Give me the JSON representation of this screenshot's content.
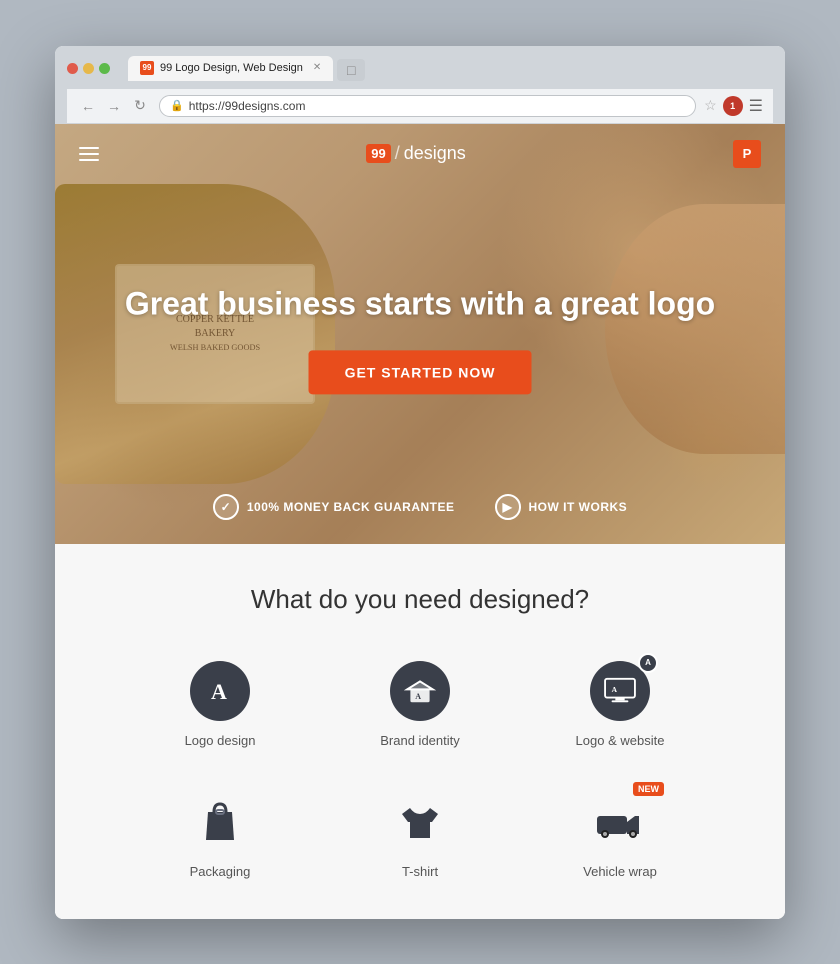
{
  "browser": {
    "tab_label": "99 Logo Design, Web Design",
    "tab_favicon": "99",
    "url": "https://99designs.com",
    "new_tab_label": "□"
  },
  "nav": {
    "logo_number": "99",
    "logo_text": "designs",
    "user_initial": "P"
  },
  "hero": {
    "title": "Great business starts with a great logo",
    "cta_label": "GET STARTED NOW",
    "badge_guarantee": "100% MONEY BACK GUARANTEE",
    "badge_how": "HOW IT WORKS"
  },
  "what_section": {
    "title": "What do you need designed?",
    "items_row1": [
      {
        "label": "Logo design",
        "icon": "letter-a"
      },
      {
        "label": "Brand identity",
        "icon": "letter-a-open"
      },
      {
        "label": "Logo & website",
        "icon": "monitor-a"
      }
    ],
    "items_row2": [
      {
        "label": "Packaging",
        "icon": "bag"
      },
      {
        "label": "T-shirt",
        "icon": "shirt"
      },
      {
        "label": "Vehicle wrap",
        "icon": "truck",
        "badge": "NEW"
      }
    ]
  }
}
